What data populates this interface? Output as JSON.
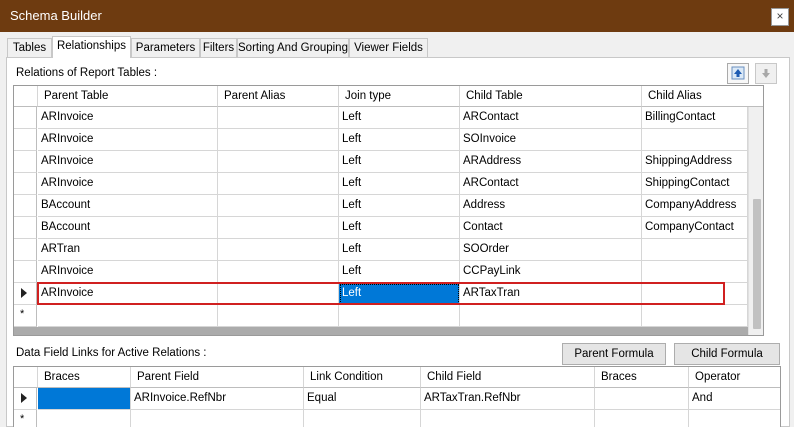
{
  "window": {
    "title": "Schema Builder",
    "close_glyph": "×"
  },
  "tabs": [
    "Tables",
    "Relationships",
    "Parameters",
    "Filters",
    "Sorting And Grouping",
    "Viewer Fields"
  ],
  "active_tab": "Relationships",
  "relations": {
    "label": "Relations of Report Tables :",
    "columns": [
      "Parent Table",
      "Parent Alias",
      "Join type",
      "Child Table",
      "Child Alias"
    ],
    "rows": [
      [
        "ARInvoice",
        "",
        "Left",
        "ARContact",
        "BillingContact"
      ],
      [
        "ARInvoice",
        "",
        "Left",
        "SOInvoice",
        ""
      ],
      [
        "ARInvoice",
        "",
        "Left",
        "ARAddress",
        "ShippingAddress"
      ],
      [
        "ARInvoice",
        "",
        "Left",
        "ARContact",
        "ShippingContact"
      ],
      [
        "BAccount",
        "",
        "Left",
        "Address",
        "CompanyAddress"
      ],
      [
        "BAccount",
        "",
        "Left",
        "Contact",
        "CompanyContact"
      ],
      [
        "ARTran",
        "",
        "Left",
        "SOOrder",
        ""
      ],
      [
        "ARInvoice",
        "",
        "Left",
        "CCPayLink",
        ""
      ],
      [
        "ARInvoice",
        "",
        "Left",
        "ARTaxTran",
        ""
      ]
    ],
    "move_up_icon": "arrow-up-icon",
    "move_down_icon": "arrow-down-icon"
  },
  "links": {
    "label": "Data Field Links for Active Relations :",
    "parent_formula_button": "Parent Formula",
    "child_formula_button": "Child Formula",
    "columns": [
      "Braces",
      "Parent Field",
      "Link Condition",
      "Child Field",
      "Braces",
      "Operator"
    ],
    "rows": [
      [
        "",
        "ARInvoice.RefNbr",
        "Equal",
        "ARTaxTran.RefNbr",
        "",
        "And"
      ]
    ]
  },
  "new_row_marker": "*",
  "colors": {
    "titlebar": "#6e3b10",
    "selection": "#0078d7",
    "highlight_box": "#d02020"
  }
}
